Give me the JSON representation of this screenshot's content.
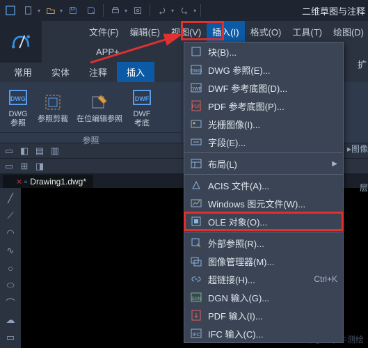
{
  "workspace_label": "二维草图与注释",
  "menubar": {
    "items": [
      {
        "label": "文件(F)"
      },
      {
        "label": "编辑(E)"
      },
      {
        "label": "视图(V)"
      },
      {
        "label": "插入(I)"
      },
      {
        "label": "格式(O)"
      },
      {
        "label": "工具(T)"
      },
      {
        "label": "绘图(D)"
      }
    ],
    "app_plus": "APP+"
  },
  "ribbon_tabs": {
    "items": [
      {
        "label": "常用"
      },
      {
        "label": "实体"
      },
      {
        "label": "注释"
      },
      {
        "label": "插入"
      }
    ]
  },
  "ribbon": {
    "panel1": {
      "title": "参照",
      "btn1_l1": "DWG",
      "btn1_l2": "参照",
      "btn2": "参照剪裁",
      "btn3": "在位编辑参照",
      "btn4_l1": "DWF",
      "btn4_l2": "考底"
    }
  },
  "right": {
    "cut1": "扩",
    "lbl1": "▸图像",
    "lbl2": "层"
  },
  "file_tab": {
    "name": "Drawing1.dwg*"
  },
  "dropdown": {
    "items": [
      {
        "icon": "block",
        "label": "块(B)..."
      },
      {
        "icon": "dwg",
        "label": "DWG 参照(E)..."
      },
      {
        "icon": "dwf",
        "label": "DWF 参考底图(D)..."
      },
      {
        "icon": "pdf",
        "label": "PDF 参考底图(P)..."
      },
      {
        "icon": "img",
        "label": "光栅图像(I)..."
      },
      {
        "icon": "field",
        "label": "字段(E)..."
      },
      {
        "sep": true
      },
      {
        "icon": "layout",
        "label": "布局(L)",
        "sub": true
      },
      {
        "sep": true
      },
      {
        "icon": "acis",
        "label": "ACIS 文件(A)..."
      },
      {
        "icon": "wmf",
        "label": "Windows 图元文件(W)..."
      },
      {
        "icon": "ole",
        "label": "OLE 对象(O)...",
        "hl": true
      },
      {
        "sep": true
      },
      {
        "icon": "xref",
        "label": "外部参照(R)..."
      },
      {
        "icon": "imgmgr",
        "label": "图像管理器(M)..."
      },
      {
        "icon": "link",
        "label": "超链接(H)...",
        "shortcut": "Ctrl+K"
      },
      {
        "icon": "dgn",
        "label": "DGN 输入(G)..."
      },
      {
        "icon": "pdfin",
        "label": "PDF 输入(I)..."
      },
      {
        "icon": "ifc",
        "label": "IFC 输入(C)..."
      }
    ]
  },
  "watermark": "搜狐号@大水牛测绘"
}
